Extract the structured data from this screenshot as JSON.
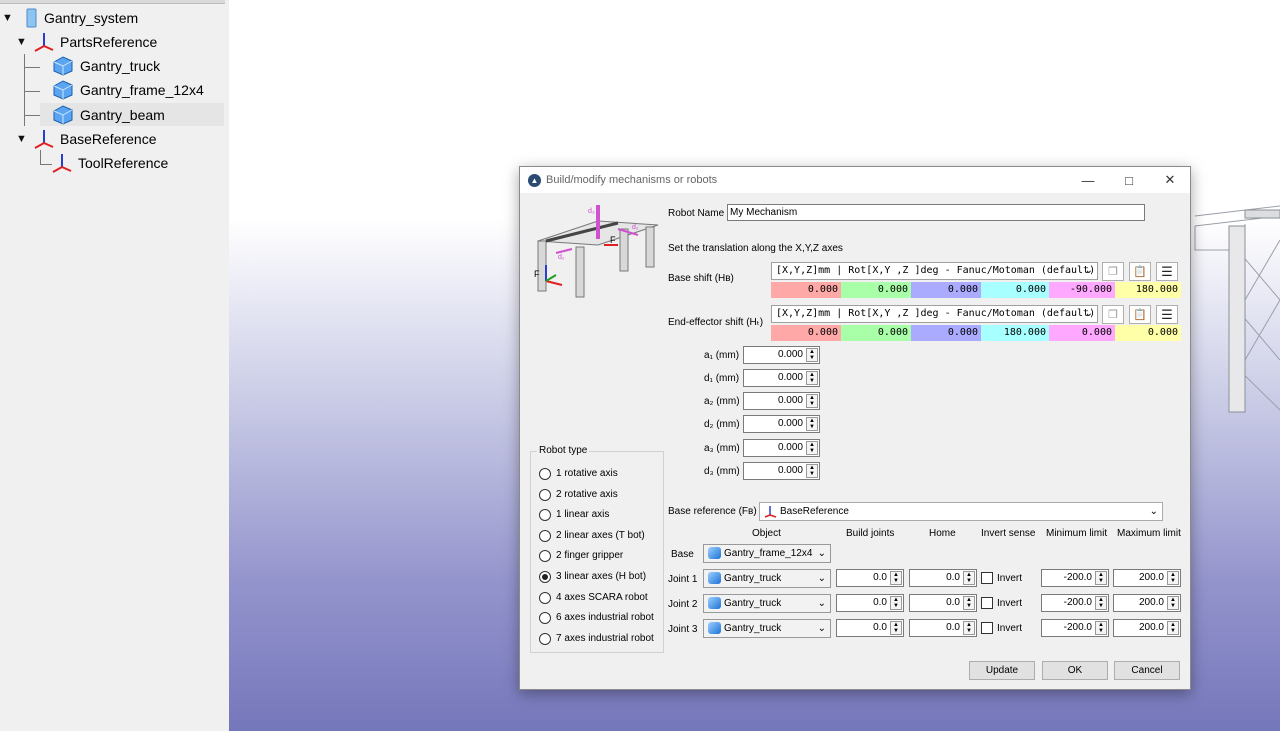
{
  "tree": {
    "items": [
      {
        "label": "Gantry_system"
      },
      {
        "label": "PartsReference"
      },
      {
        "label": "Gantry_truck"
      },
      {
        "label": "Gantry_frame_12x4"
      },
      {
        "label": "Gantry_beam"
      },
      {
        "label": "BaseReference"
      },
      {
        "label": "ToolReference"
      }
    ]
  },
  "dialog": {
    "title": "Build/modify mechanisms or robots",
    "robot_name_label": "Robot Name",
    "robot_name_value": "My Mechanism",
    "translation_hint": "Set the translation along the X,Y,Z axes",
    "base_shift": {
      "label": "Base shift (Hʙ)",
      "format": "[X,Y,Z]mm | Rot[X,Y ,Z  ]deg - Fanuc/Motoman (default)",
      "values": [
        "0.000",
        "0.000",
        "0.000",
        "0.000",
        "-90.000",
        "180.000"
      ]
    },
    "tool_shift": {
      "label": "End-effector shift (Hₜ)",
      "format": "[X,Y,Z]mm | Rot[X,Y ,Z  ]deg - Fanuc/Motoman (default)",
      "values": [
        "0.000",
        "0.000",
        "0.000",
        "180.000",
        "0.000",
        "0.000"
      ]
    },
    "params": [
      {
        "label": "a₁ (mm)",
        "value": "0.000"
      },
      {
        "label": "d₁ (mm)",
        "value": "0.000"
      },
      {
        "label": "a₂ (mm)",
        "value": "0.000"
      },
      {
        "label": "d₂ (mm)",
        "value": "0.000"
      },
      {
        "label": "a₃ (mm)",
        "value": "0.000"
      },
      {
        "label": "d₃ (mm)",
        "value": "0.000"
      }
    ],
    "robot_type": {
      "title": "Robot type",
      "options": [
        "1 rotative axis",
        "2 rotative axis",
        "1 linear axis",
        "2 linear axes (T bot)",
        "2 finger gripper",
        "3 linear axes (H bot)",
        "4 axes SCARA robot",
        "6 axes industrial robot",
        "7 axes industrial robot"
      ],
      "selected_index": 5
    },
    "base_reference_label": "Base reference (Fʙ)",
    "base_reference_value": "BaseReference",
    "columns": [
      "Object",
      "Build joints",
      "Home",
      "Invert sense",
      "Minimum limit",
      "Maximum limit"
    ],
    "base_row": {
      "label": "Base",
      "object": "Gantry_frame_12x4"
    },
    "joints": [
      {
        "label": "Joint 1",
        "object": "Gantry_truck",
        "build": "0.0",
        "home": "0.0",
        "invert_label": "Invert",
        "min": "-200.0",
        "max": "200.0"
      },
      {
        "label": "Joint 2",
        "object": "Gantry_truck",
        "build": "0.0",
        "home": "0.0",
        "invert_label": "Invert",
        "min": "-200.0",
        "max": "200.0"
      },
      {
        "label": "Joint 3",
        "object": "Gantry_truck",
        "build": "0.0",
        "home": "0.0",
        "invert_label": "Invert",
        "min": "-200.0",
        "max": "200.0"
      }
    ],
    "buttons": {
      "update": "Update",
      "ok": "OK",
      "cancel": "Cancel"
    },
    "diagram": {
      "f1": "F",
      "f2": "F",
      "d1": "d₁",
      "d2": "d₂",
      "d3": "d₃"
    }
  },
  "colors": {
    "x": "#ffa8a8",
    "y": "#a8ffa8",
    "z": "#aaaaff",
    "rx": "#a8ffff",
    "ry": "#ffa8ff",
    "rz": "#ffffa8"
  }
}
